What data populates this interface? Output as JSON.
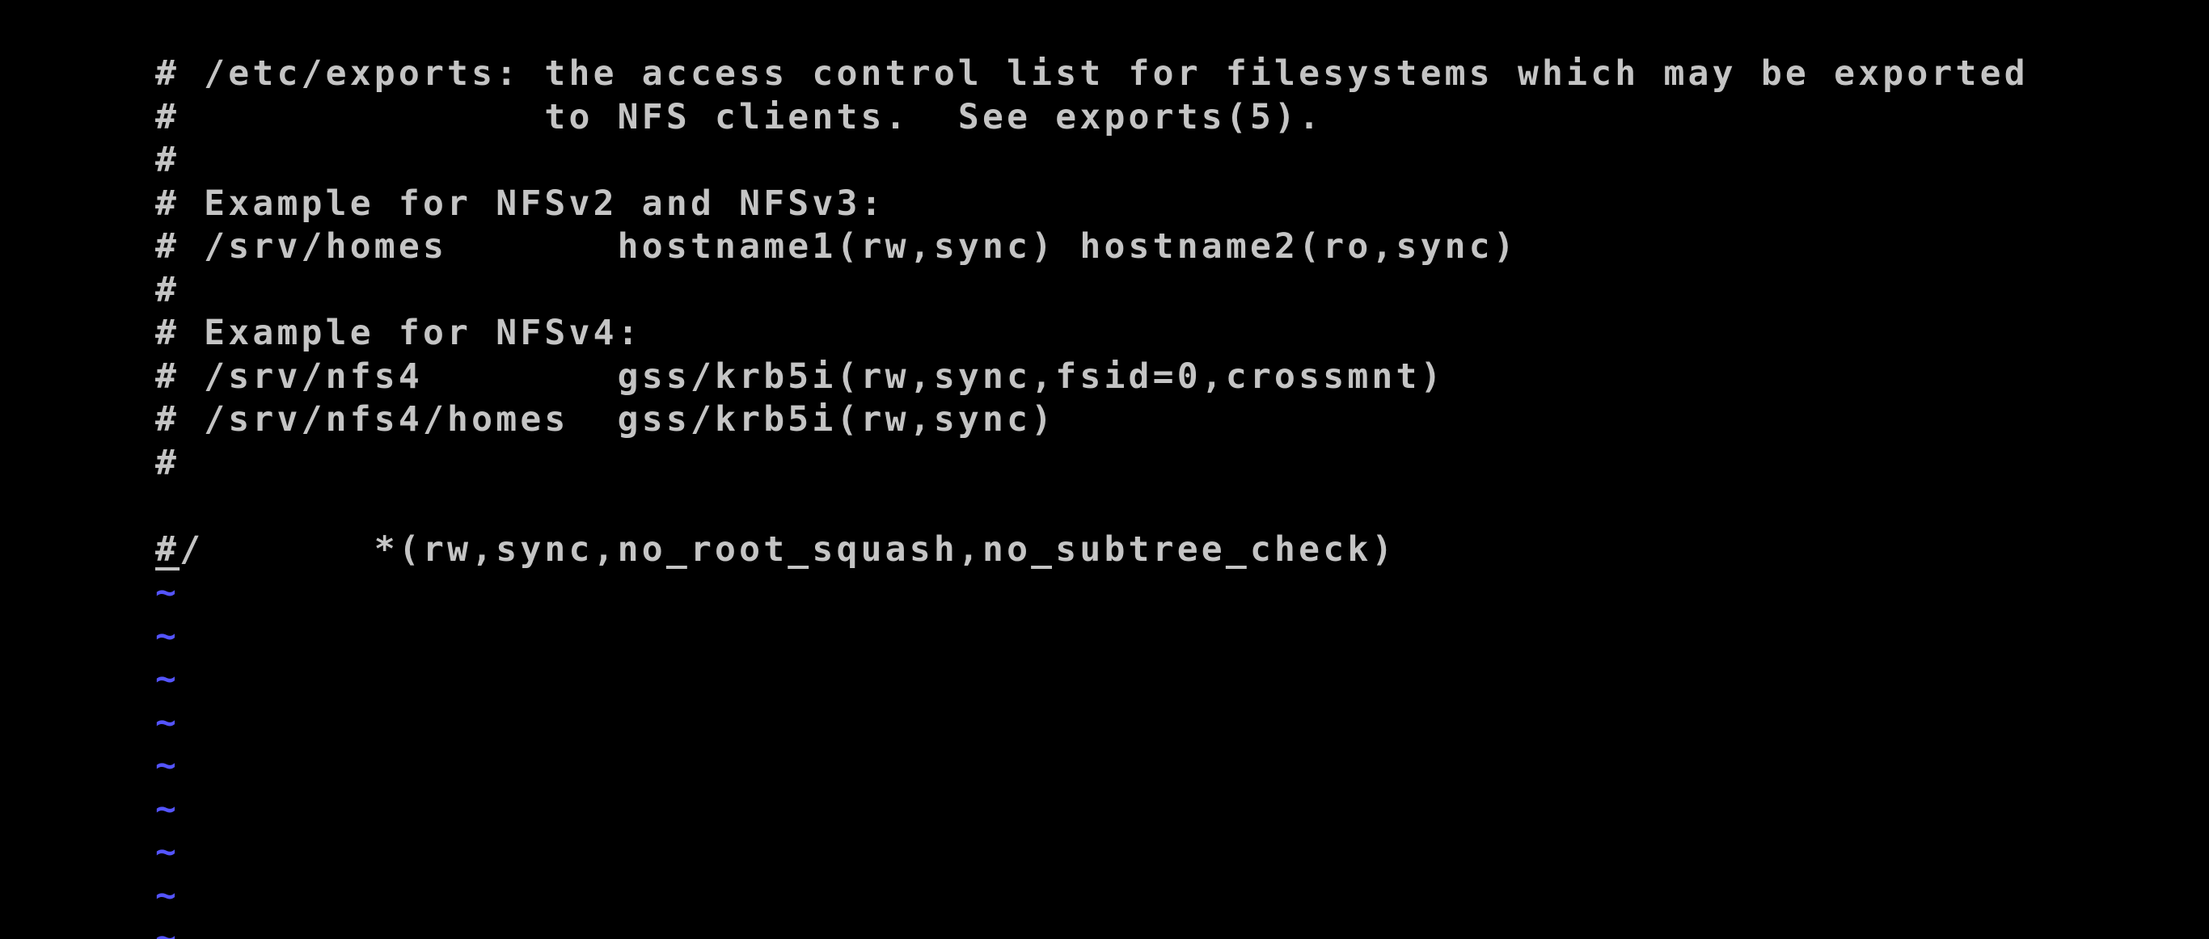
{
  "editor": {
    "lines": [
      "# /etc/exports: the access control list for filesystems which may be exported",
      "#               to NFS clients.  See exports(5).",
      "#",
      "# Example for NFSv2 and NFSv3:",
      "# /srv/homes       hostname1(rw,sync) hostname2(ro,sync)",
      "#",
      "# Example for NFSv4:",
      "# /srv/nfs4        gss/krb5i(rw,sync,fsid=0,crossmnt)",
      "# /srv/nfs4/homes  gss/krb5i(rw,sync)",
      "#",
      ""
    ],
    "cursor_line": {
      "cursor_char": "#",
      "rest": "/       *(rw,sync,no_root_squash,no_subtree_check)"
    },
    "empty_line_marker": "~",
    "empty_line_count": 9,
    "colors": {
      "background": "#000000",
      "text": "#c4c4c4",
      "tilde": "#5454ff"
    }
  }
}
